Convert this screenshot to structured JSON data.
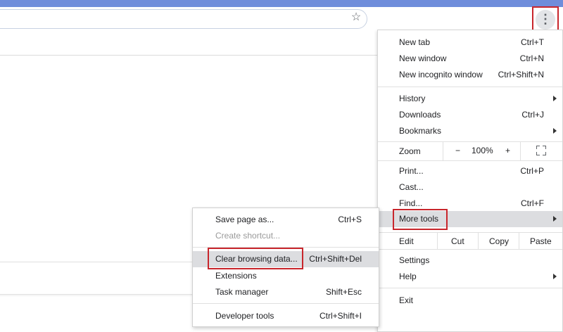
{
  "colors": {
    "accent_band": "#6f8ddb",
    "highlight": "#c8262c",
    "hover": "#dcdde0"
  },
  "toolbar": {
    "star_icon": "star-icon",
    "menu_icon": "kebab-menu-icon"
  },
  "main_menu": {
    "new_tab": {
      "label": "New tab",
      "shortcut": "Ctrl+T"
    },
    "new_window": {
      "label": "New window",
      "shortcut": "Ctrl+N"
    },
    "new_incognito": {
      "label": "New incognito window",
      "shortcut": "Ctrl+Shift+N"
    },
    "history": {
      "label": "History"
    },
    "downloads": {
      "label": "Downloads",
      "shortcut": "Ctrl+J"
    },
    "bookmarks": {
      "label": "Bookmarks"
    },
    "zoom": {
      "label": "Zoom",
      "minus": "−",
      "value": "100%",
      "plus": "+"
    },
    "print": {
      "label": "Print...",
      "shortcut": "Ctrl+P"
    },
    "cast": {
      "label": "Cast..."
    },
    "find": {
      "label": "Find...",
      "shortcut": "Ctrl+F"
    },
    "more_tools": {
      "label": "More tools"
    },
    "edit": {
      "label": "Edit",
      "cut": "Cut",
      "copy": "Copy",
      "paste": "Paste"
    },
    "settings": {
      "label": "Settings"
    },
    "help": {
      "label": "Help"
    },
    "exit": {
      "label": "Exit"
    }
  },
  "sub_menu": {
    "save_page": {
      "label": "Save page as...",
      "shortcut": "Ctrl+S"
    },
    "create_shortcut": {
      "label": "Create shortcut..."
    },
    "clear_browsing": {
      "label": "Clear browsing data...",
      "shortcut": "Ctrl+Shift+Del"
    },
    "extensions": {
      "label": "Extensions"
    },
    "task_manager": {
      "label": "Task manager",
      "shortcut": "Shift+Esc"
    },
    "dev_tools": {
      "label": "Developer tools",
      "shortcut": "Ctrl+Shift+I"
    }
  }
}
